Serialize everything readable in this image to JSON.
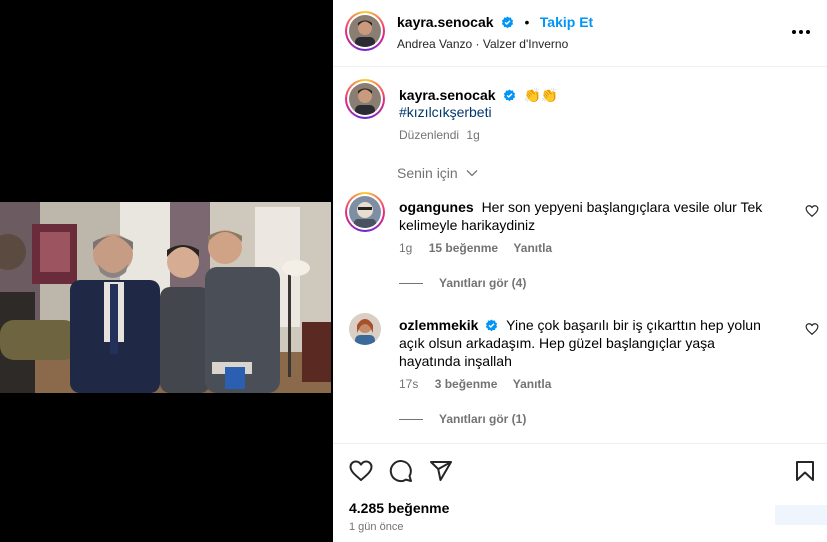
{
  "post": {
    "author": "kayra.senocak",
    "follow_separator": "•",
    "follow_label": "Takip Et",
    "audio": "Andrea Vanzo · Valzer d'Inverno",
    "caption_emoji": "👏👏",
    "hashtag": "#kızılcıkşerbeti",
    "edited": "Düzenlendi",
    "edited_time": "1g",
    "sort_label": "Senin için"
  },
  "comments": [
    {
      "username": "ogangunes",
      "verified": false,
      "text": "Her son yepyeni başlangıçlara vesile olur Tek kelimeyle harikaydiniz",
      "time": "1g",
      "likes": "15 beğenme",
      "reply_label": "Yanıtla",
      "view_replies": "Yanıtları gör (4)"
    },
    {
      "username": "ozlemmekik",
      "verified": true,
      "text": "Yine çok başarılı bir iş çıkarttın hep yolun açık olsun arkadaşım. Hep güzel başlangıçlar yaşa hayatında inşallah",
      "time": "17s",
      "likes": "3 beğenme",
      "reply_label": "Yanıtla",
      "view_replies": "Yanıtları gör (1)"
    }
  ],
  "footer": {
    "likes_count": "4.285 beğenme",
    "posted": "1 gün önce"
  },
  "icons": {
    "like": "heart-icon",
    "comment": "comment-bubble-icon",
    "share": "paper-plane-icon",
    "save": "bookmark-icon",
    "more": "more-horizontal-icon",
    "verified": "verified-badge-icon"
  },
  "colors": {
    "accent_blue": "#0095f6",
    "verified_blue": "#0095f6",
    "muted": "#737373",
    "hashtag": "#00376b"
  }
}
